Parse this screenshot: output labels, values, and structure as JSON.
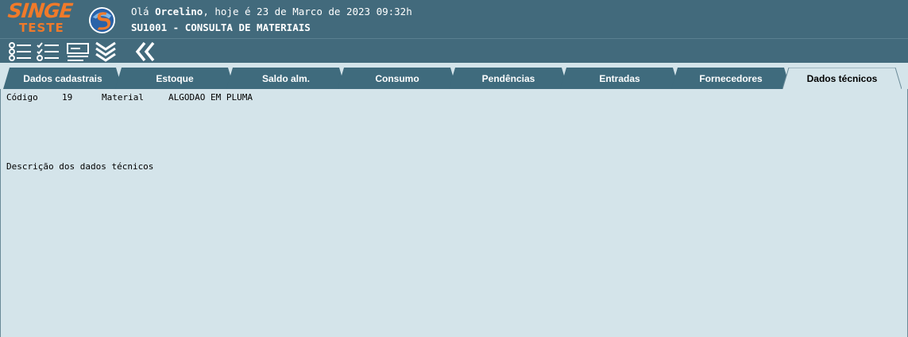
{
  "header": {
    "logo_top": "SINGE",
    "logo_bottom": "TESTE",
    "greeting_prefix": "Olá ",
    "user_name": "Orcelino",
    "greeting_suffix": ", hoje é 23 de Marco de 2023 09:32h",
    "screen_title": "SU1001 - CONSULTA DE MATERIAIS"
  },
  "toolbar": {
    "buttons": [
      "list-icon",
      "checklist-icon",
      "form-icon",
      "expand-down-icon",
      "back-icon"
    ]
  },
  "tabs": [
    {
      "label": "Dados cadastrais",
      "active": false
    },
    {
      "label": "Estoque",
      "active": false
    },
    {
      "label": "Saldo alm.",
      "active": false
    },
    {
      "label": "Consumo",
      "active": false
    },
    {
      "label": "Pendências",
      "active": false
    },
    {
      "label": "Entradas",
      "active": false
    },
    {
      "label": "Fornecedores",
      "active": false
    },
    {
      "label": "Dados técnicos",
      "active": true
    }
  ],
  "content": {
    "codigo_label": "Código",
    "codigo_value": "19",
    "material_label": "Material",
    "material_value": "ALGODAO EM PLUMA",
    "descricao_label": "Descrição dos dados técnicos"
  },
  "colors": {
    "header_bg": "#426a7c",
    "tab_bg": "#3f6b7d",
    "content_bg": "#d4e4ea",
    "logo_orange": "#f07a2a"
  }
}
